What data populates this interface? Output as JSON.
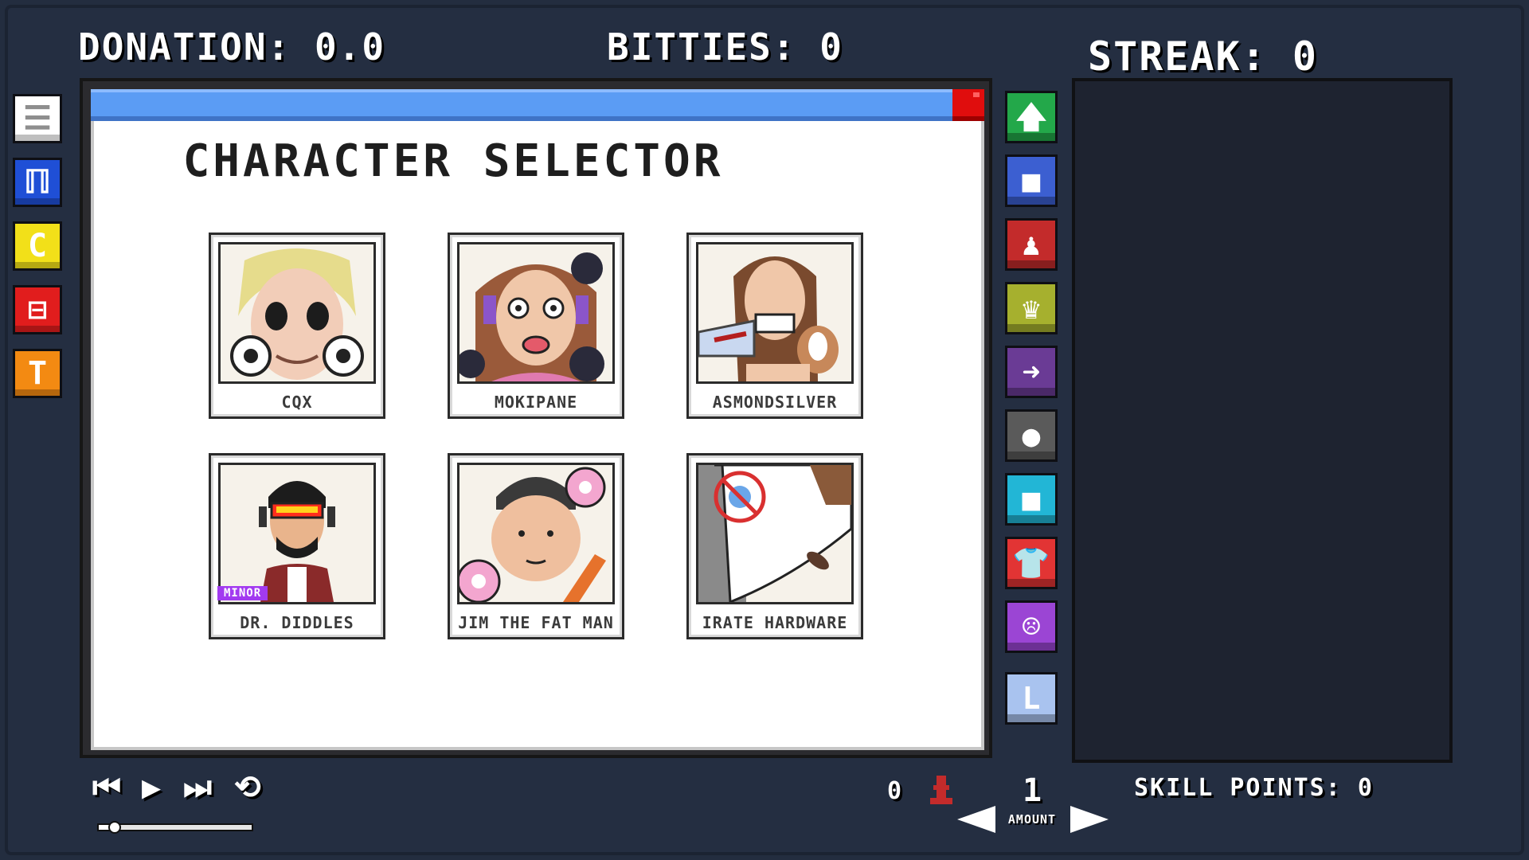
{
  "hud": {
    "donation": "DONATION: 0.0",
    "bitties": "BITTIES: 0",
    "streak": "STREAK: 0"
  },
  "left_toolbar": [
    {
      "name": "menu-button",
      "glyph": "☰",
      "icon": "menu-icon",
      "color": "#ffffff"
    },
    {
      "name": "store-button",
      "glyph": "ℿ",
      "icon": "store-icon",
      "color": "#1f4fd6"
    },
    {
      "name": "c-button",
      "glyph": "C",
      "icon": "c-icon",
      "color": "#f2e019"
    },
    {
      "name": "save-button",
      "glyph": "⊟",
      "icon": "save-icon",
      "color": "#e11d1d"
    },
    {
      "name": "t-button",
      "glyph": "T",
      "icon": "t-icon",
      "color": "#f38a12"
    }
  ],
  "window": {
    "title": "CHARACTER SELECTOR"
  },
  "characters": [
    {
      "name": "CQX",
      "badge": ""
    },
    {
      "name": "MOKIPANE",
      "badge": ""
    },
    {
      "name": "ASMONDSILVER",
      "badge": ""
    },
    {
      "name": "DR. DIDDLES",
      "badge": "MINOR"
    },
    {
      "name": "JIM THE FAT MAN",
      "badge": ""
    },
    {
      "name": "IRATE HARDWARE",
      "badge": ""
    }
  ],
  "right_toolbar": [
    {
      "name": "upgrade-button",
      "glyph": "🡅",
      "icon": "arrow-up-icon",
      "color": "#23a84a"
    },
    {
      "name": "shield-button",
      "glyph": "■",
      "icon": "shield-icon",
      "color": "#3c5fd1"
    },
    {
      "name": "unit-button",
      "glyph": "♟",
      "icon": "pawn-icon",
      "color": "#c32b2b"
    },
    {
      "name": "crown-button",
      "glyph": "♛",
      "icon": "crown-icon",
      "color": "#a6b02e"
    },
    {
      "name": "next-button",
      "glyph": "➜",
      "icon": "arrow-right-icon",
      "color": "#6a3b95"
    },
    {
      "name": "circle-button",
      "glyph": "●",
      "icon": "circle-icon",
      "color": "#5a5a5a"
    },
    {
      "name": "square-button",
      "glyph": "■",
      "icon": "square-icon",
      "color": "#22b6d6"
    },
    {
      "name": "shirt-button",
      "glyph": "👕",
      "icon": "shirt-icon",
      "color": "#e23434"
    },
    {
      "name": "face-button",
      "glyph": "☹",
      "icon": "face-icon",
      "color": "#9b45d4"
    },
    {
      "name": "l-button",
      "glyph": "L",
      "icon": "l-icon",
      "color": "#a9c3ef"
    }
  ],
  "playback": {
    "prev": "⏮",
    "play": "▶",
    "next": "⏭",
    "loop": "⟲",
    "volume": 0.1
  },
  "footer": {
    "unit_count": "0",
    "amount_value": "1",
    "amount_label": "AMOUNT",
    "skill_points": "SKILL POINTS: 0"
  }
}
